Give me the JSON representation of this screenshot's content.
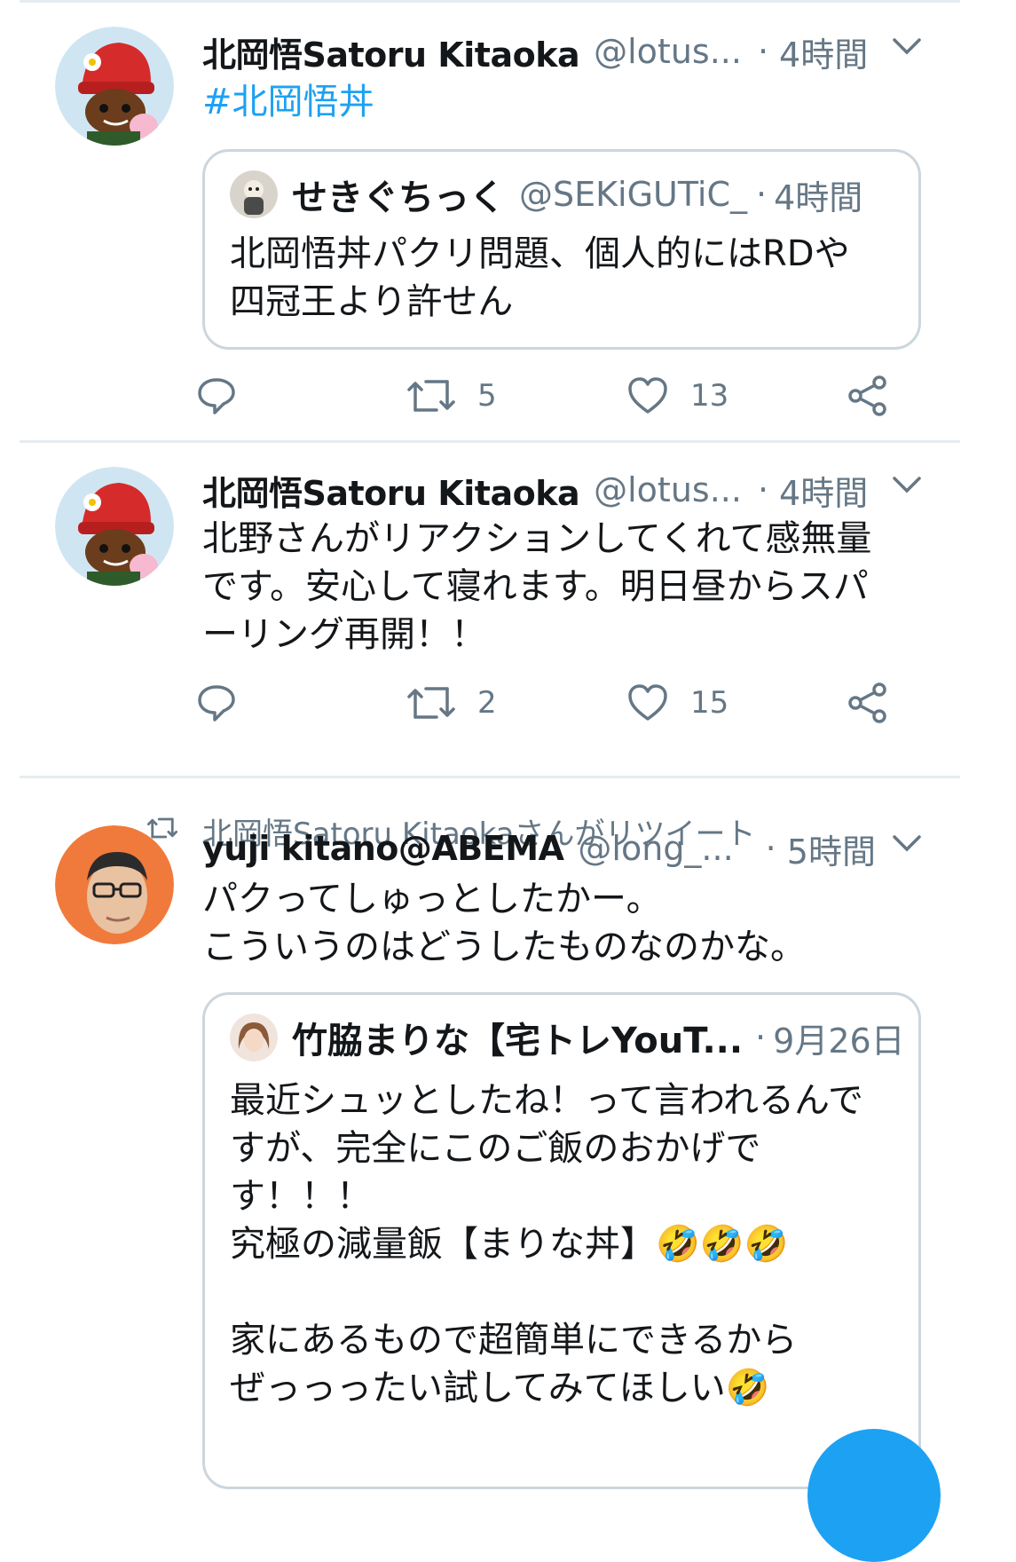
{
  "tweets": [
    {
      "name": "北岡悟Satoru Kitaoka",
      "handle": "@lotus...",
      "dot": "·",
      "time": "4時間",
      "text": "#北岡悟丼",
      "quote": {
        "name": "せきぐちっく",
        "handle": "@SEKiGUTiC_",
        "dot": "·",
        "time": "4時間",
        "text": "北岡悟丼パクリ問題、個人的にはRDや\n四冠王より許せん"
      },
      "actions": {
        "reply": "",
        "retweets": "5",
        "likes": "13"
      }
    },
    {
      "name": "北岡悟Satoru Kitaoka",
      "handle": "@lotus...",
      "dot": "·",
      "time": "4時間",
      "text": "北野さんがリアクションしてくれて感無量\nです。安心して寝れます。明日昼からスパ\nーリング再開！！",
      "actions": {
        "reply": "",
        "retweets": "2",
        "likes": "15"
      }
    },
    {
      "retweet_label": "北岡悟Satoru Kitaokaさんがリツイート",
      "name": "yuji kitano@ABEMA",
      "handle": "@long_...",
      "dot": "·",
      "time": "5時間",
      "text": "パクってしゅっとしたかー。\nこういうのはどうしたものなのかな。",
      "quote": {
        "name": "竹脇まりな【宅トレYouT...",
        "handle": "",
        "dot": "·",
        "time": "9月26日",
        "text": "最近シュッとしたね！って言われるんで\nすが、完全にこのご飯のおかげで\nす！！！\n究極の減量飯【まりな丼】🤣🤣🤣\n\n家にあるもので超簡単にできるから\nぜっっったい試してみてほしい🤣"
      }
    }
  ],
  "colors": {
    "accent": "#1da1f2",
    "secondary_text": "#657786",
    "divider": "#e6ecf0",
    "quote_border": "#ccd6dd"
  },
  "icons": [
    "reply-icon",
    "retweet-icon",
    "like-icon",
    "share-icon",
    "chevron-down-icon"
  ]
}
